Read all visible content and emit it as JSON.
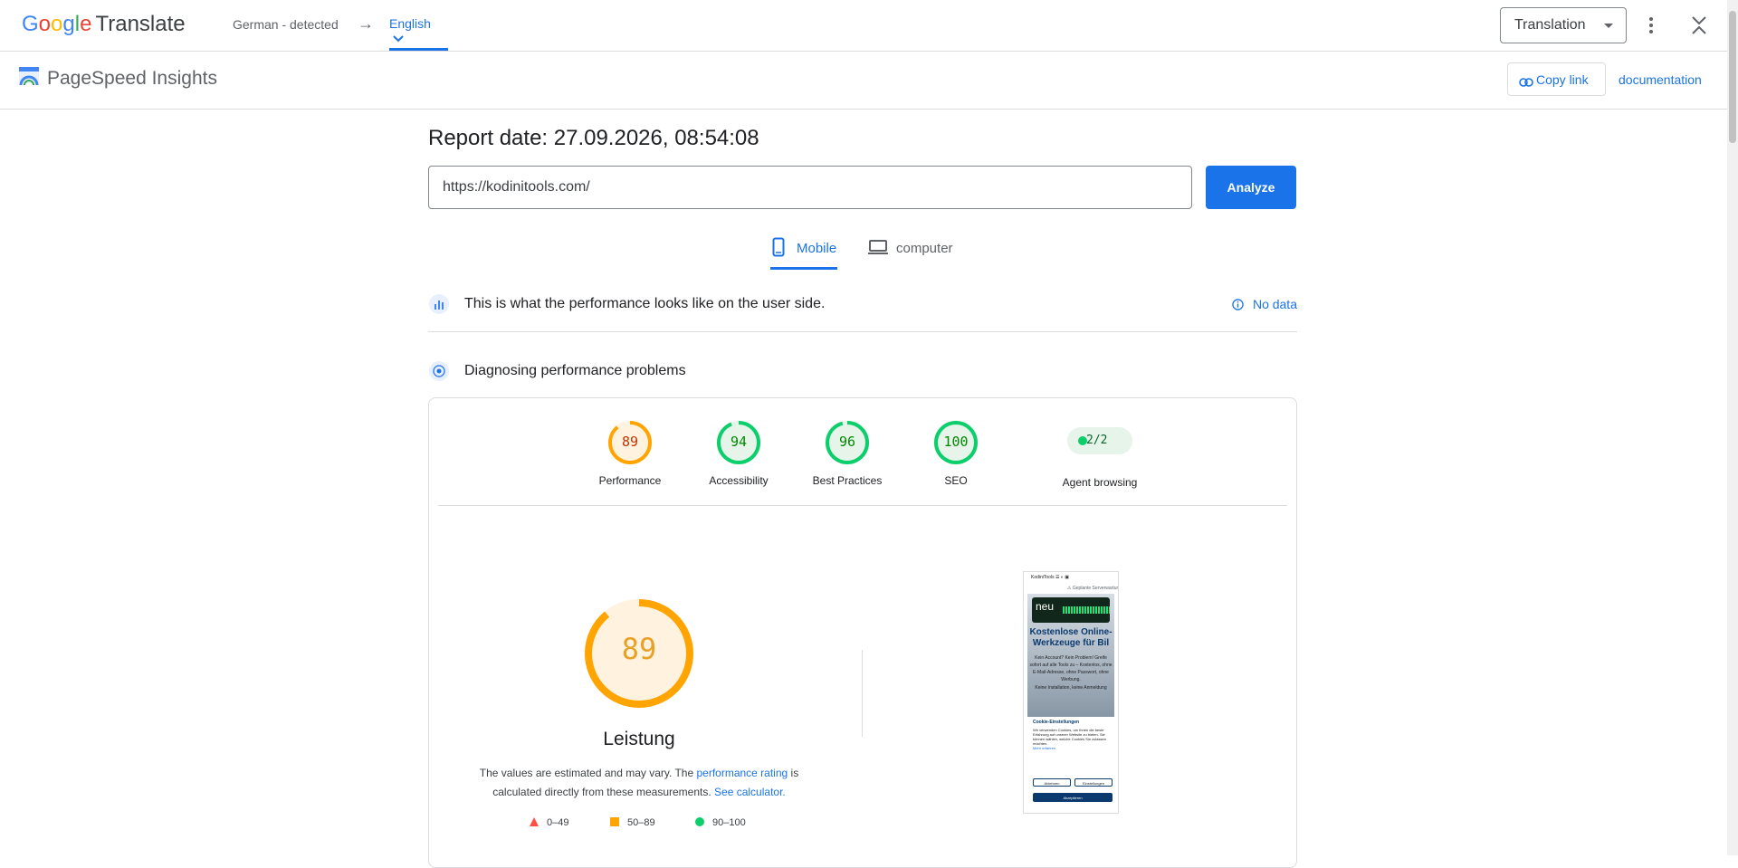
{
  "translate_bar": {
    "logo_google": "Google",
    "logo_translate": "Translate",
    "source_language": "German - detected",
    "arrow": "→",
    "target_language": "English",
    "mode_select": "Translation",
    "icons": [
      "more-vert-icon",
      "close-icon",
      "chevron-down-icon"
    ]
  },
  "header": {
    "title": "PageSpeed Insights",
    "copy_link": "Copy link",
    "documentation": "documentation"
  },
  "main": {
    "report_date": "Report date: 27.09.2026, 08:54:08",
    "url_value": "https://kodinitools.com/",
    "analyze": "Analyze",
    "tabs": [
      {
        "label": "Mobile",
        "active": true
      },
      {
        "label": "computer",
        "active": false
      }
    ],
    "field_data_text": "This is what the performance looks like on the user side.",
    "no_data": "No data",
    "diagnose_text": "Diagnosing performance problems"
  },
  "scores": [
    {
      "label": "Performance",
      "value": "89",
      "score": 89,
      "color": "#ffa400"
    },
    {
      "label": "Accessibility",
      "value": "94",
      "score": 94,
      "color": "#0cce6b"
    },
    {
      "label": "Best Practices",
      "value": "96",
      "score": 96,
      "color": "#0cce6b"
    },
    {
      "label": "SEO",
      "value": "100",
      "score": 100,
      "color": "#0cce6b"
    }
  ],
  "agent": {
    "label": "Agent browsing",
    "value": "2/2"
  },
  "performance": {
    "score": "89",
    "label": "Leistung",
    "desc_1": "The values are estimated and may vary. The ",
    "desc_link": "performance rating",
    "desc_2": " is calculated directly from these measurements. ",
    "desc_calc": "See calculator.",
    "legend": [
      {
        "range": "0–49",
        "color": "#ff4e42"
      },
      {
        "range": "50–89",
        "color": "#ffa400"
      },
      {
        "range": "90–100",
        "color": "#0cce6b"
      }
    ]
  },
  "screenshot": {
    "brand": "KodiniTools",
    "warning": "⚠ Geplante Serverwartung: A",
    "badge": "neu",
    "heading": "Kostenlose Online-Werkzeuge für Bil",
    "body": "Kein Account? Kein Problem! Greife sofort auf alle Tools zu – Kostenlos, ohne E-Mail-Adresse, ohne Passwort, ohne Werbung.",
    "body2": "Keine Installation, keine Anmeldung",
    "cookie_title": "Cookie-Einstellungen",
    "cookie_text": "Wir verwenden Cookies, um Ihnen die beste Erfahrung auf unserer Website zu bieten. Sie können wählen, welche Cookies Sie zulassen möchten.",
    "cookie_more": "Mehr erfahren",
    "reject": "Ablehnen",
    "settings": "Einstellungen",
    "accept": "Akzeptieren"
  },
  "colors": {
    "accent": "#1a73e8",
    "average": "#ffa400",
    "good": "#0cce6b",
    "poor": "#ff4e42"
  }
}
